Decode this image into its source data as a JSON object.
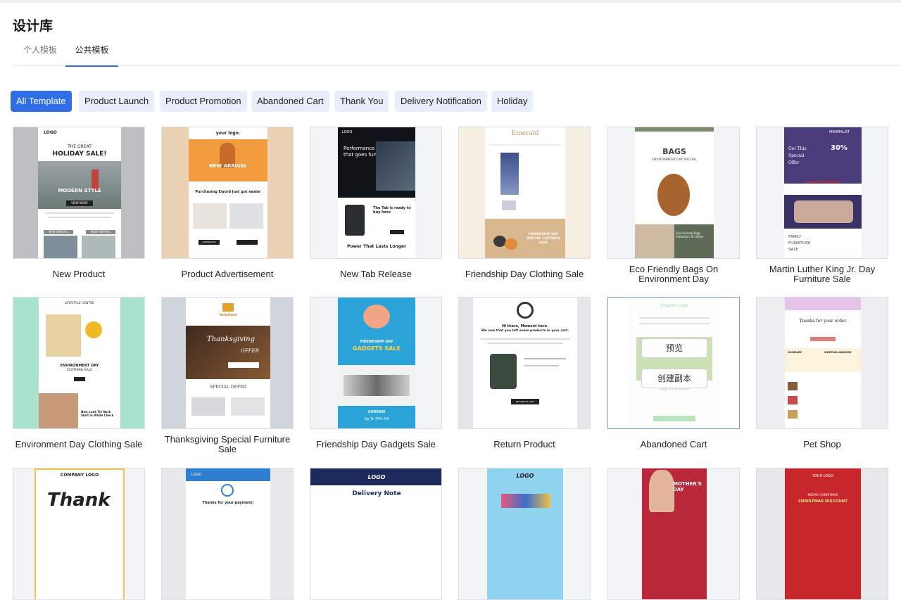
{
  "page": {
    "title": "设计库"
  },
  "tabs": [
    {
      "label": "个人模板"
    },
    {
      "label": "公共模板"
    }
  ],
  "filters": [
    {
      "label": "All Template"
    },
    {
      "label": "Product Launch"
    },
    {
      "label": "Product Promotion"
    },
    {
      "label": "Abandoned Cart"
    },
    {
      "label": "Thank You"
    },
    {
      "label": "Delivery Notification"
    },
    {
      "label": "Holiday"
    }
  ],
  "templates": [
    {
      "name": "New Product",
      "thumb": {
        "logo": "LOGO",
        "kicker": "THE GREAT",
        "headline": "HOLIDAY SALE!",
        "overlay": "MODERN STYLE",
        "cta": "VIEW MORE",
        "tag1": "NEW ARRIVAL",
        "tag2": "NEW ARRIVAL"
      }
    },
    {
      "name": "Product Advertisement",
      "thumb": {
        "logo": "your logo.",
        "headline": "NEW ARRIVAL",
        "sub": "Purchasing Eword just got easier",
        "cta": "ORDER NOW"
      }
    },
    {
      "name": "New Tab Release",
      "thumb": {
        "logo": "LOGO",
        "headline": "Performance that goes further",
        "sub": "The Tab is ready to buy here",
        "footer": "Power That Lasts Longer"
      }
    },
    {
      "name": "Friendship Day Clothing Sale",
      "thumb": {
        "logo": "Emerald",
        "promo": "FRIENDSHIP DAY SPECIAL CLOTHING SALE"
      }
    },
    {
      "name": "Eco Friendly Bags On Environment Day",
      "thumb": {
        "headline": "BAGS",
        "sub": "ENVIRONMENT DAY SPECIAL",
        "promo": "Eco Friendly Bags Collection On 20ms"
      }
    },
    {
      "name": "Martin Luther King Jr. Day Furniture Sale",
      "thumb": {
        "logo": "MINIMALIST",
        "offer": "Get This Special Offer",
        "pct": "30%",
        "banner": "ALWAYS REMBER",
        "footer": "FAMILY FURNITURE SALE"
      }
    },
    {
      "name": "Environment Day Clothing Sale",
      "thumb": {
        "logo": "LIFESTYLE CENTER",
        "headline": "ENVIRONMENT DAY",
        "sub": "CLOTHING SALE",
        "promo": "New Look Tie Neck Shirt In White Check"
      }
    },
    {
      "name": "Thanksgiving Special Furniture Sale",
      "thumb": {
        "logo": "furniture",
        "headline": "Thanksgiving",
        "sub": "OFFER",
        "section": "SPECIAL OFFER"
      }
    },
    {
      "name": "Friendship Day Gadgets Sale",
      "thumb": {
        "headline": "FRIENDSHIP DAY",
        "sub": "GADGETS SALE",
        "brand": "CORENSI",
        "footer": "Up To 70% Off"
      }
    },
    {
      "name": "Return Product",
      "thumb": {
        "headline": "Hi there, Moment here.",
        "sub": "We saw that you left some products in your cart.",
        "cta": "RETURN TO CART"
      }
    },
    {
      "name": "Abandoned Cart",
      "thumb": {
        "logo": "Organic Logo",
        "preview": "预览",
        "create": "创建副本",
        "sub": "Bag of Lemon"
      }
    },
    {
      "name": "Pet Shop",
      "thumb": {
        "headline": "Thanks for your order",
        "col1": "SUMMARY",
        "col2": "SHIPPING ADDRESS"
      }
    },
    {
      "name": "",
      "thumb": {
        "logo": "COMPANY LOGO",
        "headline": "Thank"
      }
    },
    {
      "name": "",
      "thumb": {
        "logo": "LOGO",
        "headline": "Thanks for your payment!"
      }
    },
    {
      "name": "",
      "thumb": {
        "logo": "LOGO",
        "headline": "Delivery Note"
      }
    },
    {
      "name": "",
      "thumb": {
        "logo": "LOGO"
      }
    },
    {
      "name": "",
      "thumb": {
        "headline": "MOTHER'S DAY"
      }
    },
    {
      "name": "",
      "thumb": {
        "logo": "YOUR LOGO",
        "headline": "MERRY CHRISTMAS",
        "sub": "CHRISTMAS DISCOUNT"
      }
    }
  ]
}
